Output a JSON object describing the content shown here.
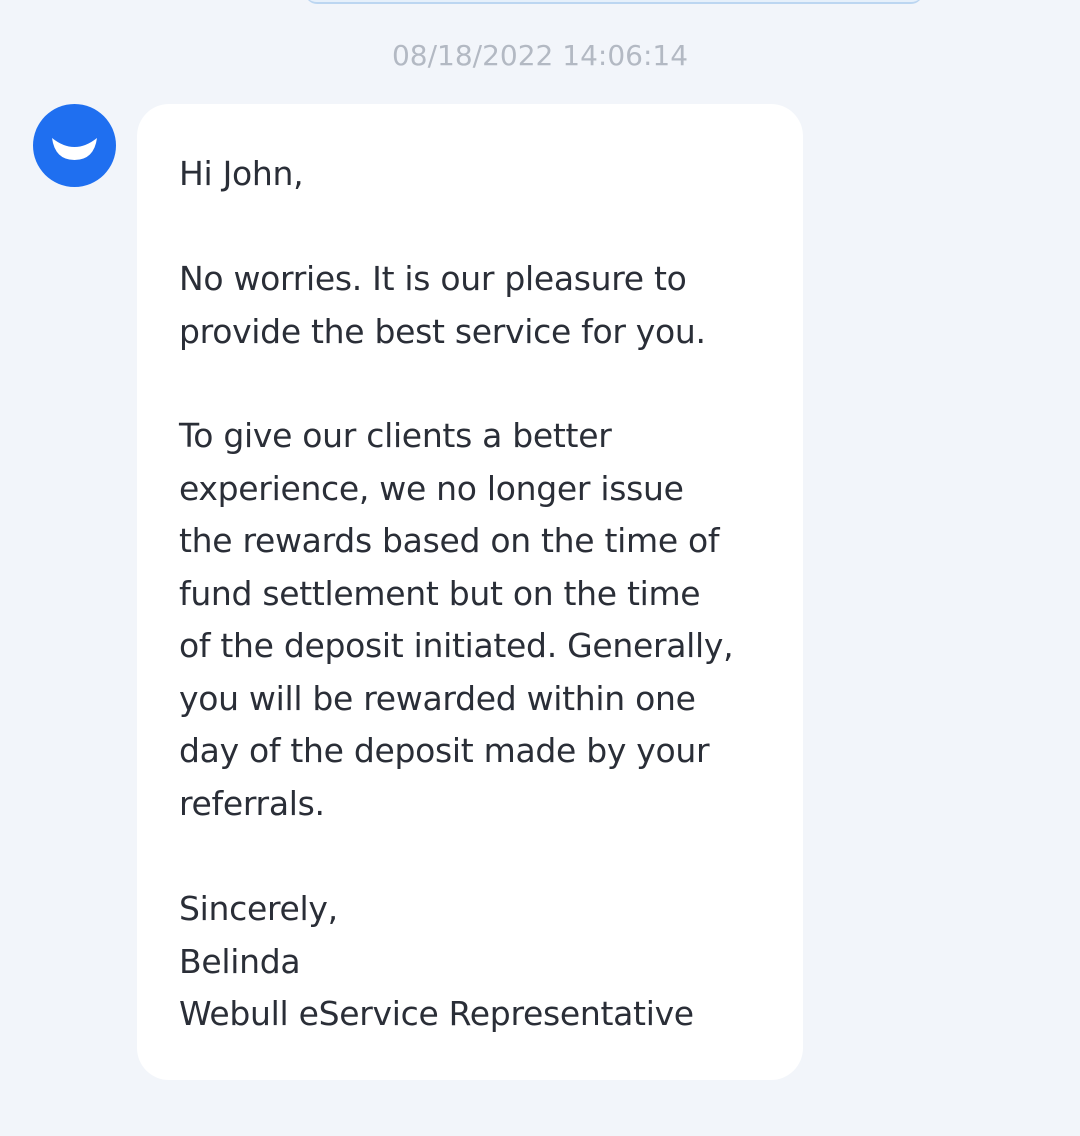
{
  "chat": {
    "timestamp": "08/18/2022 14:06:14",
    "avatar_icon": "webull-smile-logo-icon",
    "brand_color": "#1f6ff0",
    "message": {
      "greeting": "Hi John,",
      "paragraph_1": "No worries. It is our pleasure to\nprovide the best service for you.",
      "paragraph_2": "To give our clients a better\nexperience, we no longer issue\nthe rewards based on the time of\nfund settlement but on the time\nof the deposit initiated. Generally,\nyou will be rewarded within one\nday of the deposit made by your\nreferrals.",
      "closing": "Sincerely,",
      "signer_name": "Belinda",
      "signer_title": "Webull eService Representative"
    }
  }
}
